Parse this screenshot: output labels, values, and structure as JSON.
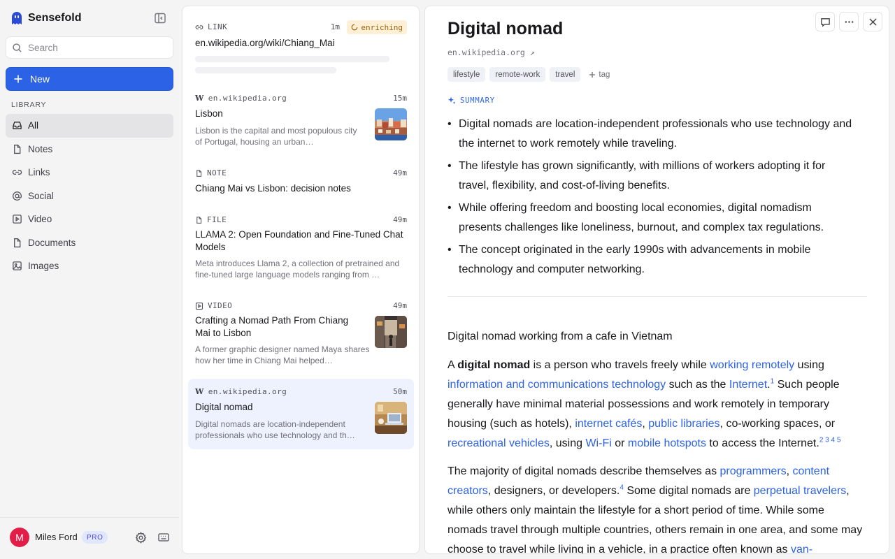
{
  "app": {
    "name": "Sensefold"
  },
  "search": {
    "placeholder": "Search"
  },
  "new_button": {
    "label": "New"
  },
  "library": {
    "label": "LIBRARY",
    "items": [
      {
        "label": "All",
        "icon": "inbox-icon",
        "active": true
      },
      {
        "label": "Notes",
        "icon": "note-icon"
      },
      {
        "label": "Links",
        "icon": "link-icon"
      },
      {
        "label": "Social",
        "icon": "at-icon"
      },
      {
        "label": "Video",
        "icon": "video-icon"
      },
      {
        "label": "Documents",
        "icon": "document-icon"
      },
      {
        "label": "Images",
        "icon": "image-icon"
      }
    ]
  },
  "user": {
    "initial": "M",
    "name": "Miles Ford",
    "plan": "PRO"
  },
  "list": [
    {
      "type": "LINK",
      "time": "1m",
      "status": "enriching",
      "title": "en.wikipedia.org/wiki/Chiang_Mai"
    },
    {
      "type": "en.wikipedia.org",
      "time": "15m",
      "title": "Lisbon",
      "desc": "Lisbon is the capital and most populous city of Portugal, housing an urban…"
    },
    {
      "type": "NOTE",
      "time": "49m",
      "title": "Chiang Mai vs Lisbon: decision notes"
    },
    {
      "type": "FILE",
      "time": "49m",
      "title": "LLAMA 2: Open Foundation and Fine-Tuned Chat Models",
      "desc": "Meta introduces Llama 2, a collection of pretrained and fine-tuned large language models ranging from …"
    },
    {
      "type": "VIDEO",
      "time": "49m",
      "title": "Crafting a Nomad Path From Chiang Mai to Lisbon",
      "desc": "A former graphic designer named Maya shares how her time in Chiang Mai helped…"
    },
    {
      "type": "en.wikipedia.org",
      "time": "50m",
      "title": "Digital nomad",
      "desc": "Digital nomads are location-independent professionals who use technology and th…"
    }
  ],
  "detail": {
    "title": "Digital nomad",
    "source": "en.wikipedia.org ↗",
    "tags": [
      "lifestyle",
      "remote-work",
      "travel"
    ],
    "add_tag": "tag",
    "summary_label": "SUMMARY",
    "summary": [
      "Digital nomads are location-independent professionals who use technology and the internet to work remotely while traveling.",
      "The lifestyle has grown significantly, with millions of workers adopting it for travel, flexibility, and cost-of-living benefits.",
      "While offering freedom and boosting local economies, digital nomadism presents challenges like loneliness, burnout, and complex tax regulations.",
      "The concept originated in the early 1990s with advancements in mobile technology and computer networking."
    ],
    "caption": "Digital nomad working from a cafe in Vietnam",
    "p1": {
      "t1": "A ",
      "bold": "digital nomad",
      "t2": " is a person who travels freely while ",
      "l1": "working remotely",
      "t3": " using ",
      "l2": "information and communications technology",
      "t4": " such as the ",
      "l3": "Internet",
      "t5": ".",
      "s1": "1",
      "t6": " Such people generally have minimal material possessions and work remotely in temporary housing (such as hotels), ",
      "l4": "internet cafés",
      "t7": ", ",
      "l5": "public libraries",
      "t8": ", co-working spaces, or ",
      "l6": "recreational vehicles",
      "t9": ", using ",
      "l7": "Wi-Fi",
      "t10": " or ",
      "l8": "mobile hotspots",
      "t11": " to access the Internet.",
      "s2": "2 3 4 5"
    },
    "p2": {
      "t1": "The majority of digital nomads describe themselves as ",
      "l1": "programmers",
      "t2": ", ",
      "l2": "content creators",
      "t3": ", designers, or developers.",
      "s1": "4",
      "t4": " Some digital nomads are ",
      "l3": "perpetual travelers",
      "t5": ", while others only maintain the lifestyle for a short period of time. While some nomads travel through multiple countries, others remain in one area, and some may choose to travel while living in a vehicle, in a practice often known as ",
      "l4": "van-"
    }
  }
}
